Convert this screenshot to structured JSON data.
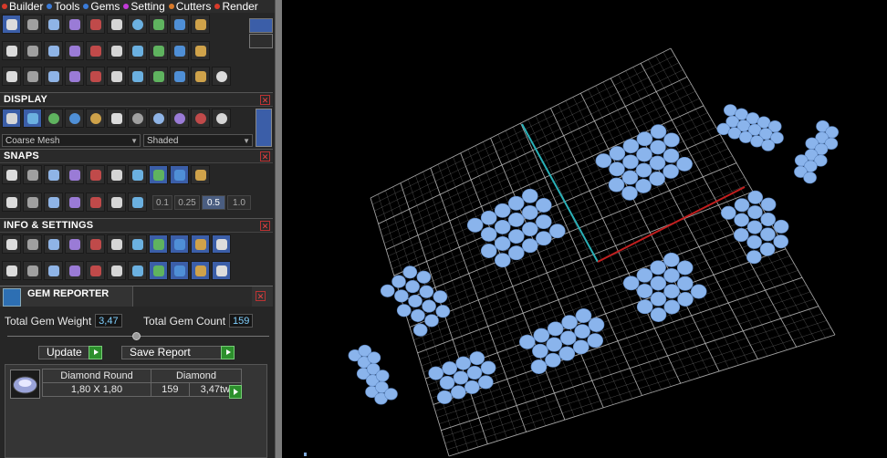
{
  "menubar": {
    "items": [
      {
        "label": "Builder",
        "color": "#d93a2a"
      },
      {
        "label": "Tools",
        "color": "#3a7bd9"
      },
      {
        "label": "Gems",
        "color": "#3a7bd9"
      },
      {
        "label": "Setting",
        "color": "#c23ad9"
      },
      {
        "label": "Cutters",
        "color": "#d97a2a"
      },
      {
        "label": "Render",
        "color": "#d93a2a"
      }
    ]
  },
  "display": {
    "title": "DISPLAY",
    "mesh_select": "Coarse Mesh",
    "shade_select": "Shaded"
  },
  "snaps": {
    "title": "SNAPS",
    "values": [
      "0.1",
      "0.25",
      "0.5",
      "1.0"
    ],
    "active_value": "0.5"
  },
  "info": {
    "title": "INFO & SETTINGS"
  },
  "gem_reporter": {
    "title": "GEM REPORTER",
    "weight_label": "Total Gem Weight",
    "weight_value": "3,47",
    "count_label": "Total Gem Count",
    "count_value": "159",
    "update_label": "Update",
    "save_label": "Save Report",
    "table": {
      "name": "Diamond Round",
      "material": "Diamond",
      "size": "1,80 X 1,80",
      "count": "159",
      "weight": "3,47tw"
    }
  },
  "colors": {
    "gem_fill": "#8ab4ec",
    "grid_line": "#bdbdbd",
    "axis_x": "#c21f1f",
    "axis_y": "#2ab1b8",
    "panel_bg": "#262626"
  },
  "icons": {
    "builder_row1": [
      "plane-icon",
      "curve-icon",
      "curve-rail-icon",
      "curve-twist-icon",
      "gem-cluster-icon",
      "pear-gem-icon",
      "gem-ring-icon",
      "tube-icon",
      "gear-icon",
      "layout-icon"
    ],
    "builder_row2": [
      "surface-icon",
      "diamond-icon",
      "plate-icon",
      "slab-icon",
      "prism-icon",
      "loft-icon",
      "sweep-icon",
      "gear-outline-icon",
      "grid-icon",
      "molecule-icon"
    ],
    "builder_row3": [
      "cube-icon",
      "arc-icon",
      "curve-edit-icon",
      "split-icon",
      "move-icon",
      "mirror-icon",
      "blend-icon",
      "group-icon",
      "ungroup-icon",
      "boolean-icon",
      "ring-icon"
    ],
    "display_row": [
      "wireframe-icon",
      "figure-icon",
      "sphere-blue-icon",
      "sphere-purple-icon",
      "globe-icon",
      "grid-green-icon",
      "sphere-gray-icon",
      "sphere-glass-icon",
      "sphere-gold-icon",
      "sphere-white-icon",
      "sphere-chrome-icon"
    ],
    "snaps_row1": [
      "snap-end-icon",
      "snap-curve-icon",
      "snap-mid-icon",
      "snap-point-icon",
      "snap-perp-icon",
      "snap-center-icon",
      "snap-circle-icon",
      "snap-grid-icon",
      "snap-line-icon",
      "snap-box-icon"
    ],
    "snaps_row2": [
      "window-grid-icon",
      "box-icon",
      "pencil-icon",
      "grid-diag-icon",
      "plane-tilt-icon",
      "pointer-icon",
      "grid-lock-icon"
    ],
    "info_row1": [
      "settings-icon",
      "search-icon",
      "printer-icon",
      "cube-open-icon",
      "scroll-icon",
      "edit-icon",
      "cube-purple-icon",
      "brush-icon",
      "frame-icon",
      "frame-icon-2",
      "frame-icon-3"
    ],
    "info_row2": [
      "windows-icon",
      "monitor-icon",
      "cage-icon",
      "cylinder-icon",
      "filter-icon",
      "cursor-cube-icon",
      "report-icon",
      "pipette-icon",
      "gizmo-icon",
      "gizmo-icon-2",
      "gizmo-icon-3"
    ]
  }
}
